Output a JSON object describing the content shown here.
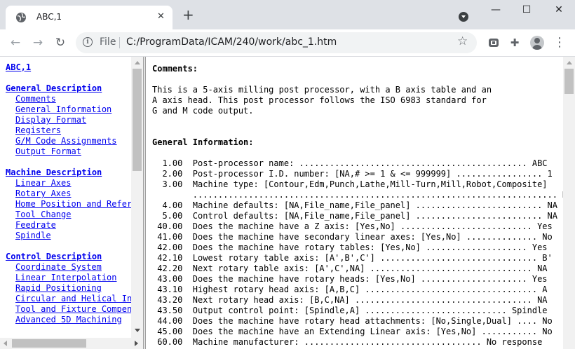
{
  "browser": {
    "tab_title": "ABC,1",
    "close_glyph": "✕",
    "new_tab_glyph": "+",
    "minimize_glyph": "—",
    "maximize_glyph": "☐",
    "window_close_glyph": "✕",
    "back_glyph": "←",
    "forward_glyph": "→",
    "reload_glyph": "↻",
    "info_glyph": "i",
    "file_label": "File",
    "url": "C:/ProgramData/ICAM/240/work/abc_1.htm",
    "star_glyph": "☆",
    "extension_glyph": "✚",
    "menu_glyph": "⋮",
    "icons": [
      "globe-icon",
      "close-icon",
      "plus-icon",
      "tab-search-icon",
      "minimize-icon",
      "maximize-icon",
      "window-close-icon",
      "back-icon",
      "forward-icon",
      "reload-icon",
      "info-icon",
      "star-icon",
      "cast-icon",
      "puzzle-icon",
      "avatar-icon",
      "more-menu-icon"
    ]
  },
  "nav": {
    "title": "ABC,1",
    "sections": [
      {
        "heading": "General Description",
        "items": [
          "Comments",
          "General Information",
          "Display Format",
          "Registers",
          "G/M Code Assignments",
          "Output Format"
        ]
      },
      {
        "heading": "Machine Description",
        "items": [
          "Linear Axes",
          "Rotary Axes",
          "Home Position and Refer",
          "Tool Change",
          "Feedrate",
          "Spindle"
        ]
      },
      {
        "heading": "Control Description",
        "items": [
          "Coordinate System",
          "Linear Interpolation",
          "Rapid Positioning",
          "Circular and Helical In",
          "Tool and Fixture Compen",
          "Advanced 5D Machining"
        ]
      }
    ]
  },
  "content": {
    "comments_heading": "Comments:",
    "comments_lines": [
      "This is a 5-axis milling post processor, with a B axis table and an",
      "A axis head. This post processor follows the ISO 6983 standard for",
      "G and M code output."
    ],
    "general_heading": "General Information:",
    "info_lines": [
      "  1.00  Post-processor name: ............................................. ABC",
      "  2.00  Post-processor I.D. number: [NA,# >= 1 & <= 999999] ................. 1",
      "  3.00  Machine type: [Contour,Edm,Punch,Lathe,Mill-Turn,Mill,Robot,Composite]",
      "        ........................................................................ Mill",
      "  4.00  Machine defaults: [NA,File_name,File_panel] ......................... NA",
      "  5.00  Control defaults: [NA,File_name,File_panel] ......................... NA",
      " 40.00  Does the machine have a Z axis: [Yes,No] .......................... Yes",
      " 41.00  Does the machine have secondary linear axes: [Yes,No] .............. No",
      " 42.00  Does the machine have rotary tables: [Yes,No] .................... Yes",
      " 42.10  Lowest rotary table axis: [A',B',C'] ............................... B'",
      " 42.20  Next rotary table axis: [A',C',NA] ................................ NA",
      " 43.00  Does the machine have rotary heads: [Yes,No] ..................... Yes",
      " 43.10  Highest rotary head axis: [A,B,C] .................................. A",
      " 43.20  Next rotary head axis: [B,C,NA] ................................... NA",
      " 43.50  Output control point: [Spindle,A] ............................ Spindle",
      " 44.00  Does the machine have rotary head attachments: [No,Single,Dual] .... No",
      " 45.00  Does the machine have an Extending Linear axis: [Yes,No] ........... No",
      " 60.00  Machine manufacturer: ................................... No response"
    ]
  },
  "colors": {
    "link": "#0000ee",
    "tabbar": "#dee1e6",
    "omnibox": "#f1f3f4"
  }
}
